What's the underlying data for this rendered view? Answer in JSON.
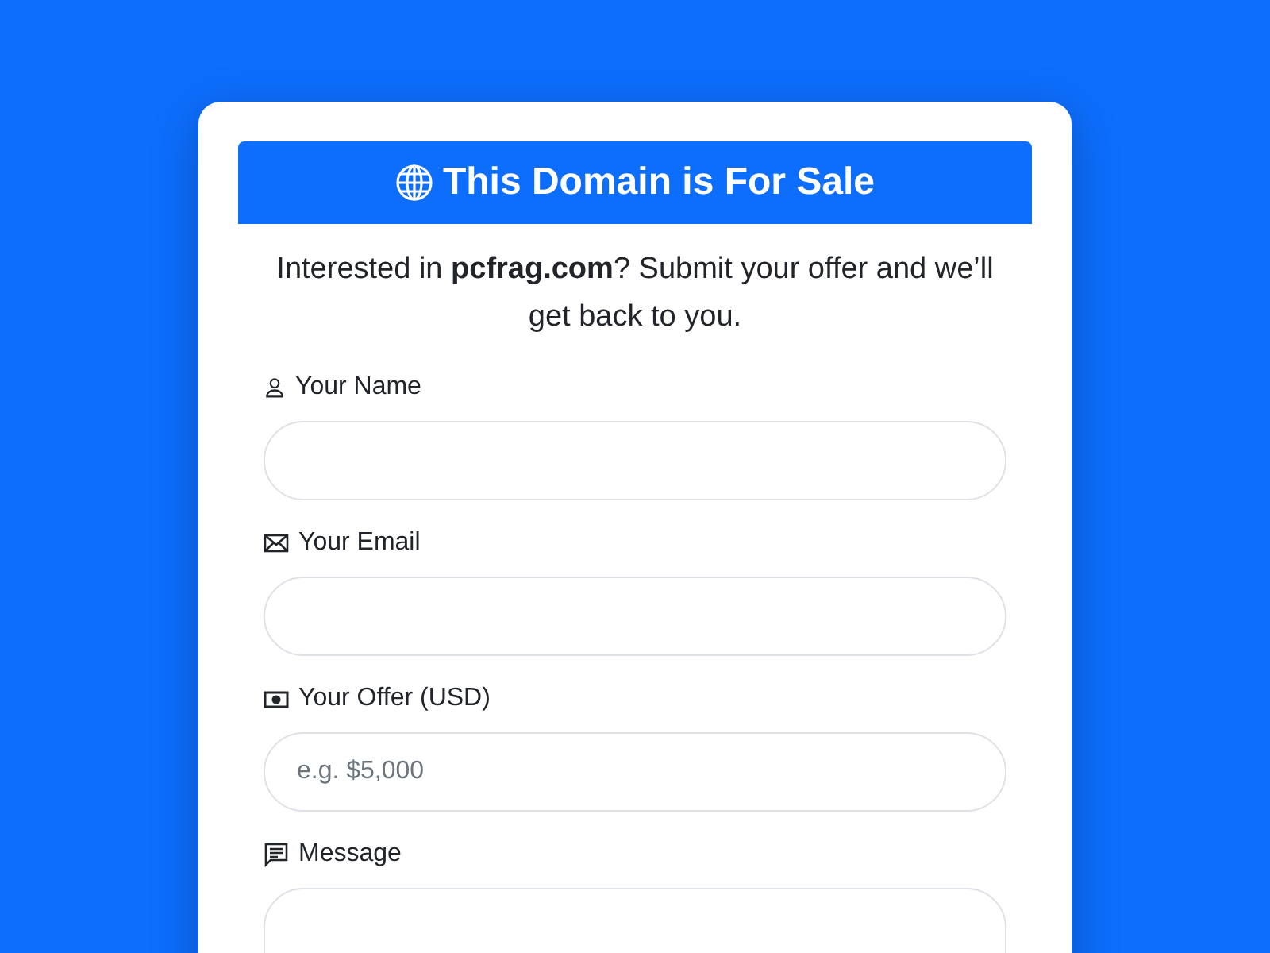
{
  "header": {
    "title": "This Domain is For Sale"
  },
  "intro": "Interested in **pcfrag.com**? Submit your offer and we’ll get back to you.",
  "fields": [
    {
      "kind": "name",
      "label": "Your Name"
    },
    {
      "kind": "email",
      "label": "Your Email"
    },
    {
      "kind": "offer",
      "label": "Your Offer (USD)",
      "placeholder": "e.g. $5,000"
    },
    {
      "kind": "message",
      "label": "Message"
    }
  ]
}
